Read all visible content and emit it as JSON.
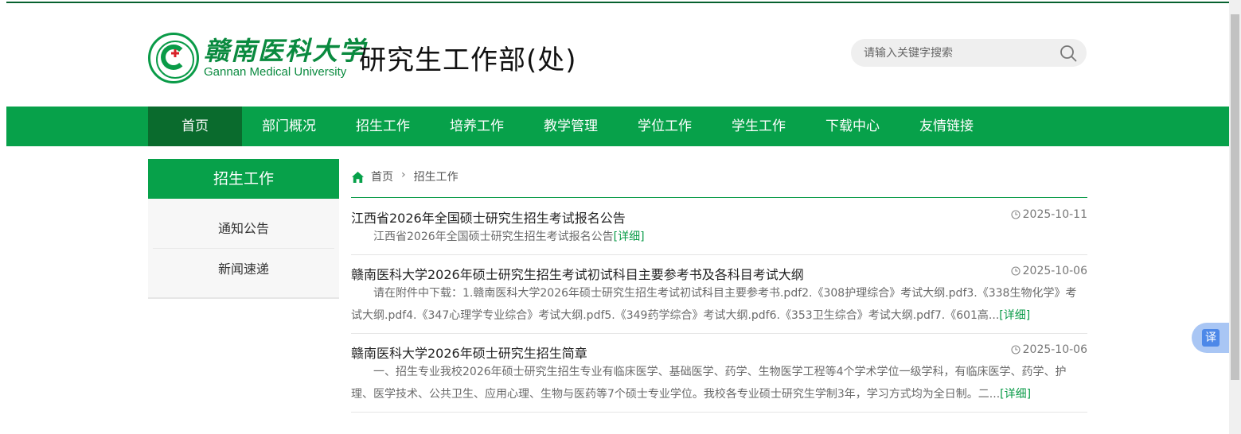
{
  "header": {
    "logo_cn": "赣南医科大学",
    "logo_en": "Gannan Medical University",
    "site_title": "研究生工作部(处)",
    "search_placeholder": "请输入关键字搜索"
  },
  "nav": [
    {
      "label": "首页",
      "active": true
    },
    {
      "label": "部门概况"
    },
    {
      "label": "招生工作"
    },
    {
      "label": "培养工作"
    },
    {
      "label": "教学管理"
    },
    {
      "label": "学位工作"
    },
    {
      "label": "学生工作"
    },
    {
      "label": "下载中心"
    },
    {
      "label": "友情链接"
    }
  ],
  "sidebar": {
    "title": "招生工作",
    "items": [
      {
        "label": "通知公告"
      },
      {
        "label": "新闻速递"
      }
    ]
  },
  "breadcrumb": {
    "home": "首页",
    "sep": "›",
    "current": "招生工作"
  },
  "news": [
    {
      "title": "江西省2026年全国硕士研究生招生考试报名公告",
      "date": "2025-10-11",
      "summary": "江西省2026年全国硕士研究生招生考试报名公告",
      "more": "[详细]"
    },
    {
      "title": "赣南医科大学2026年硕士研究生招生考试初试科目主要参考书及各科目考试大纲",
      "date": "2025-10-06",
      "summary": "请在附件中下载：1.赣南医科大学2026年硕士研究生招生考试初试科目主要参考书.pdf2.《308护理综合》考试大纲.pdf3.《338生物化学》考试大纲.pdf4.《347心理学专业综合》考试大纲.pdf5.《349药学综合》考试大纲.pdf6.《353卫生综合》考试大纲.pdf7.《601高...",
      "more": "[详细]"
    },
    {
      "title": "赣南医科大学2026年硕士研究生招生简章",
      "date": "2025-10-06",
      "summary": "一、招生专业我校2026年硕士研究生招生专业有临床医学、基础医学、药学、生物医学工程等4个学术学位一级学科，有临床医学、药学、护理、医学技术、公共卫生、应用心理、生物与医药等7个硕士专业学位。我校各专业硕士研究生学制3年，学习方式均为全日制。二...",
      "more": "[详细]"
    }
  ],
  "translate_label": "译",
  "colors": {
    "brand_green": "#07a14a",
    "nav_active": "#0a6b2d",
    "link_green": "#0a9b48"
  }
}
